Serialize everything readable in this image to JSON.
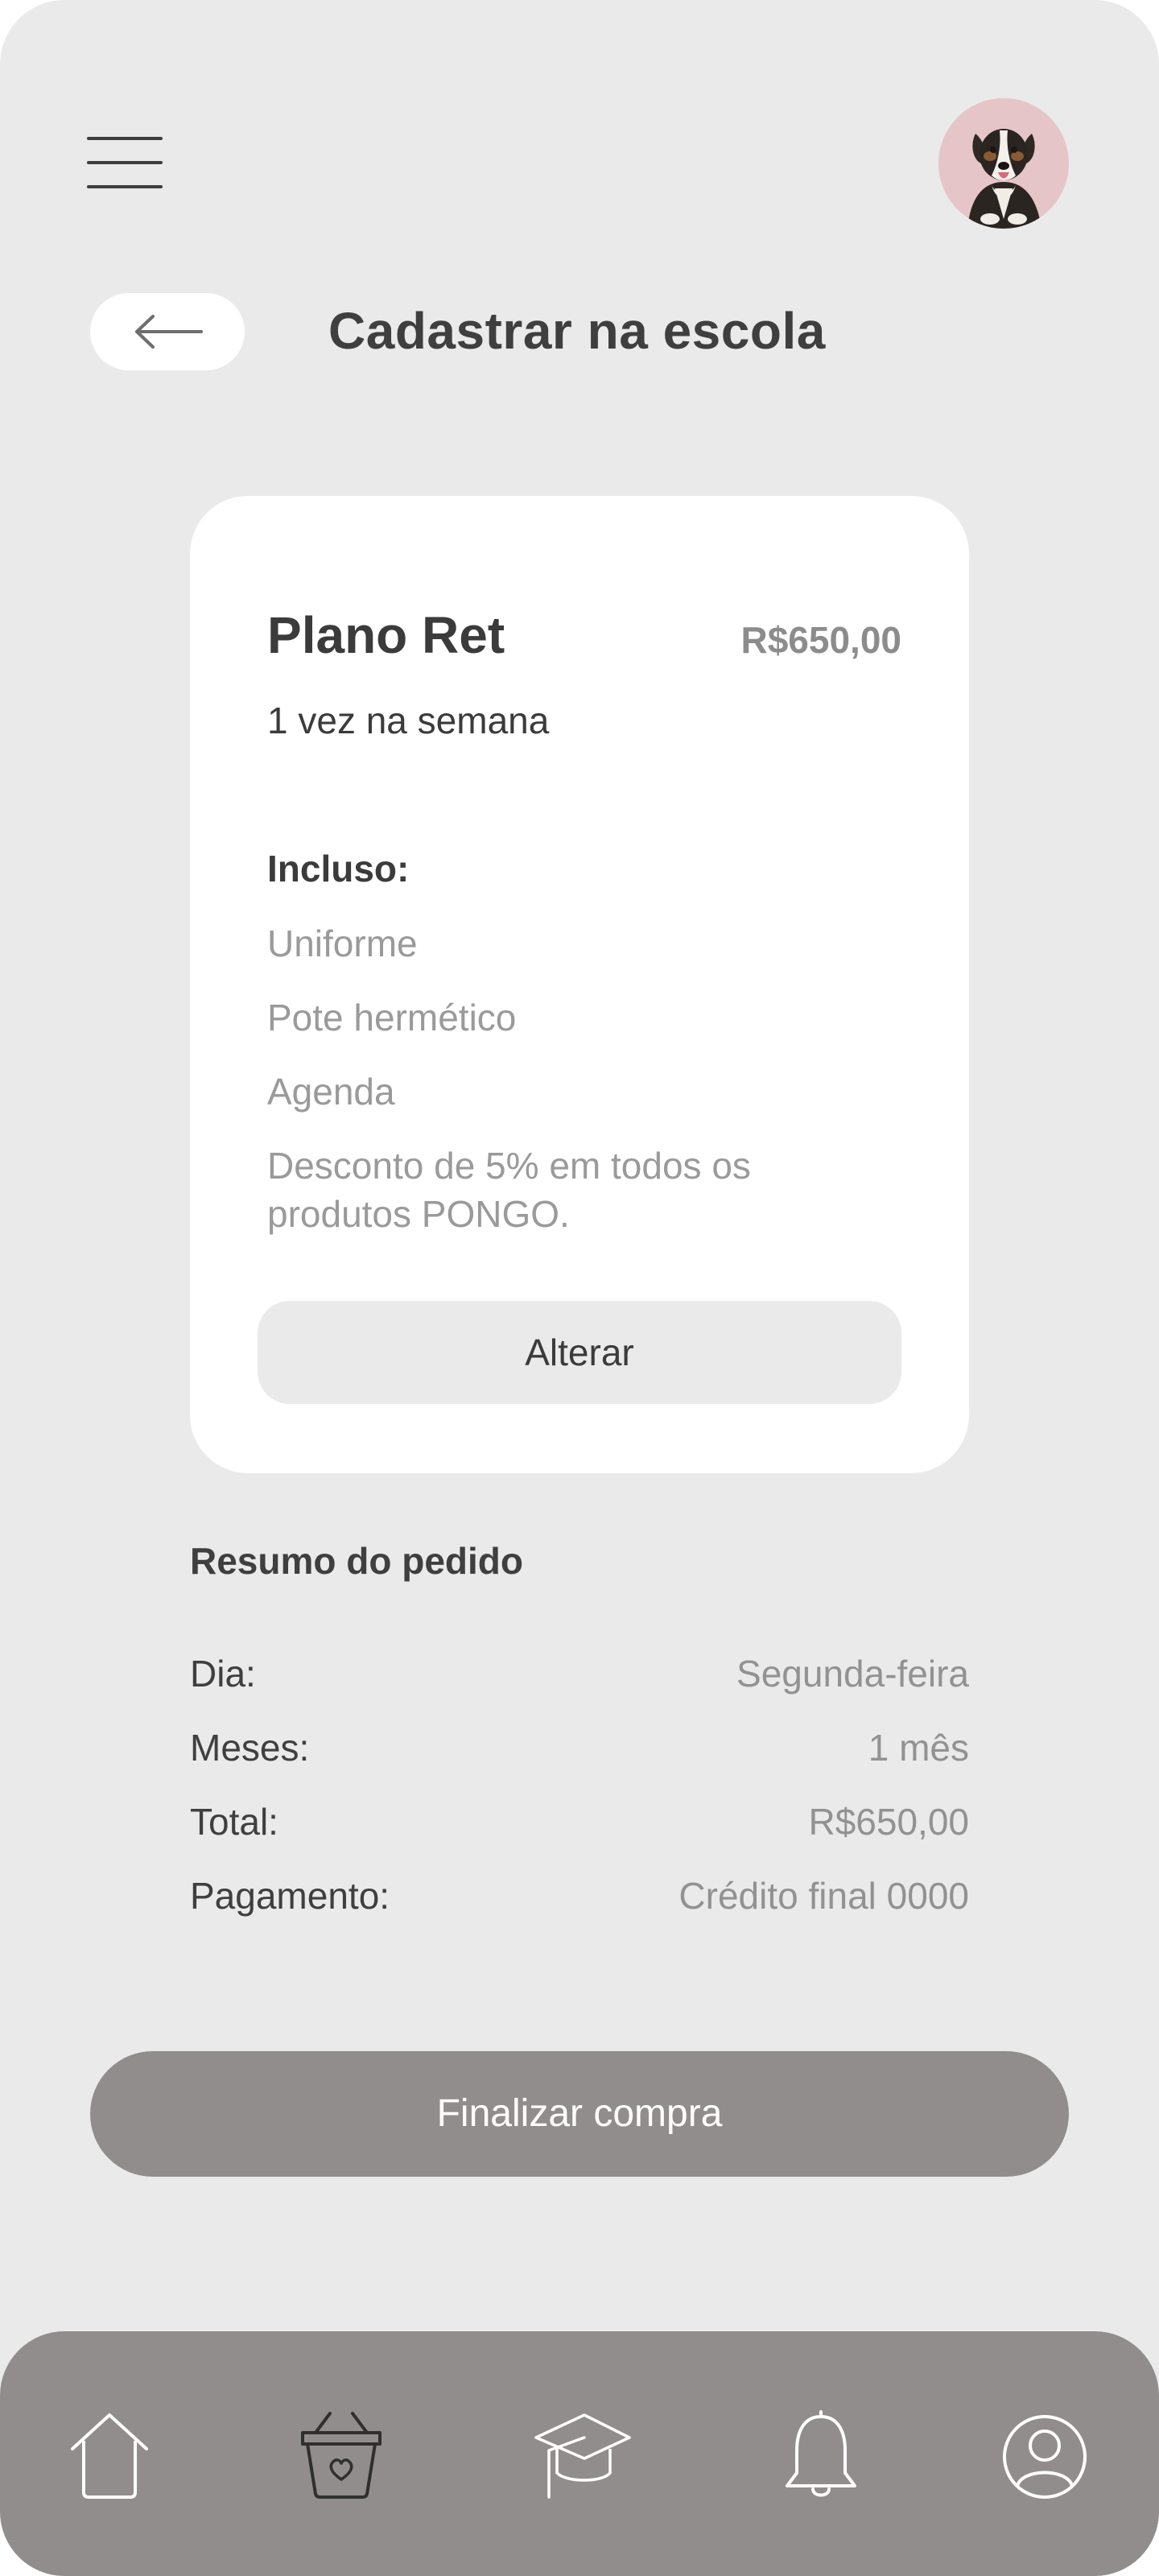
{
  "header": {
    "menu_icon": "hamburger-menu-icon",
    "avatar_icon": "dog-avatar"
  },
  "page": {
    "back_icon": "arrow-left-icon",
    "title": "Cadastrar na escola"
  },
  "plan": {
    "name": "Plano Ret",
    "price": "R$650,00",
    "frequency": "1 vez na semana",
    "included_title": "Incluso:",
    "included_items": [
      "Uniforme",
      "Pote hermético",
      "Agenda",
      "Desconto de 5% em todos os produtos PONGO."
    ],
    "change_label": "Alterar"
  },
  "summary": {
    "title": "Resumo do pedido",
    "rows": [
      {
        "label": "Dia:",
        "value": "Segunda-feira"
      },
      {
        "label": "Meses:",
        "value": "1 mês"
      },
      {
        "label": "Total:",
        "value": "R$650,00"
      },
      {
        "label": "Pagamento:",
        "value": "Crédito final 0000"
      }
    ]
  },
  "checkout": {
    "label": "Finalizar compra"
  },
  "bottom_nav": {
    "items": [
      {
        "icon": "home-icon"
      },
      {
        "icon": "basket-icon"
      },
      {
        "icon": "graduation-cap-icon"
      },
      {
        "icon": "bell-icon"
      },
      {
        "icon": "user-icon"
      }
    ]
  },
  "colors": {
    "background": "#eaeaea",
    "card": "#ffffff",
    "primary_button": "#928d8d",
    "text_dark": "#3f3f3f",
    "text_muted": "#929292",
    "avatar_bg": "#e6c5c8"
  }
}
